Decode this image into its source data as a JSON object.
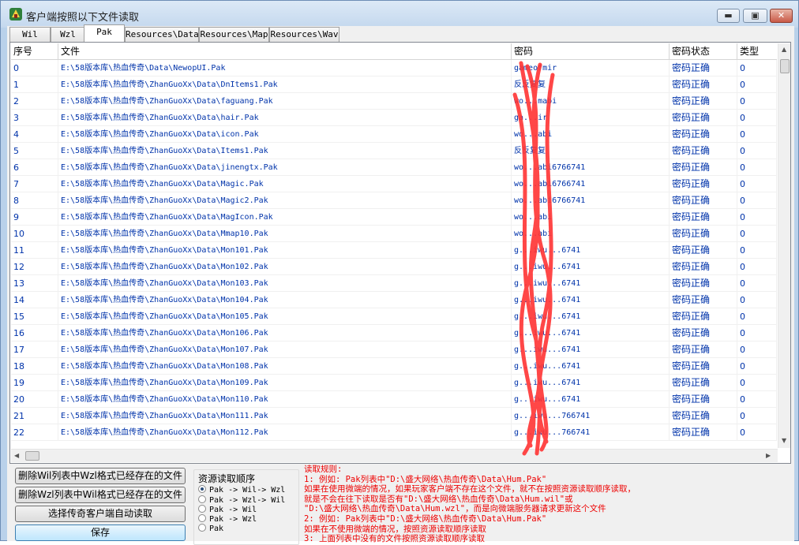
{
  "window": {
    "title": "客户端按照以下文件读取",
    "minimize_label": "▬",
    "maximize_label": "▣",
    "close_label": "✕"
  },
  "tabs": [
    {
      "label": "Wil"
    },
    {
      "label": "Wzl"
    },
    {
      "label": "Pak"
    },
    {
      "label": "Resources\\Data"
    },
    {
      "label": "Resources\\Map"
    },
    {
      "label": "Resources\\Wav"
    }
  ],
  "active_tab": "Pak",
  "table": {
    "columns": [
      "序号",
      "文件",
      "密码",
      "密码状态",
      "类型"
    ],
    "rows": [
      {
        "index": "0",
        "file": "E:\\58版本库\\热血传奇\\Data\\NewopUI.Pak",
        "password": "gameofmir",
        "status": "密码正确",
        "type": "0"
      },
      {
        "index": "1",
        "file": "E:\\58版本库\\热血传奇\\ZhanGuoXx\\Data\\DnItems1.Pak",
        "password": "反反复复",
        "status": "密码正确",
        "type": "0"
      },
      {
        "index": "2",
        "file": "E:\\58版本库\\热血传奇\\ZhanGuoXx\\Data\\faguang.Pak",
        "password": "wo...mabi",
        "status": "密码正确",
        "type": "0"
      },
      {
        "index": "3",
        "file": "E:\\58版本库\\热血传奇\\ZhanGuoXx\\Data\\hair.Pak",
        "password": "ga...ir",
        "status": "密码正确",
        "type": "0"
      },
      {
        "index": "4",
        "file": "E:\\58版本库\\热血传奇\\ZhanGuoXx\\Data\\icon.Pak",
        "password": "wo...abi",
        "status": "密码正确",
        "type": "0"
      },
      {
        "index": "5",
        "file": "E:\\58版本库\\热血传奇\\ZhanGuoXx\\Data\\Items1.Pak",
        "password": "反反复复",
        "status": "密码正确",
        "type": "0"
      },
      {
        "index": "6",
        "file": "E:\\58版本库\\热血传奇\\ZhanGuoXx\\Data\\jinengtx.Pak",
        "password": "wo...abi6766741",
        "status": "密码正确",
        "type": "0"
      },
      {
        "index": "7",
        "file": "E:\\58版本库\\热血传奇\\ZhanGuoXx\\Data\\Magic.Pak",
        "password": "wo...abi6766741",
        "status": "密码正确",
        "type": "0"
      },
      {
        "index": "8",
        "file": "E:\\58版本库\\热血传奇\\ZhanGuoXx\\Data\\Magic2.Pak",
        "password": "wo...abi6766741",
        "status": "密码正确",
        "type": "0"
      },
      {
        "index": "9",
        "file": "E:\\58版本库\\热血传奇\\ZhanGuoXx\\Data\\MagIcon.Pak",
        "password": "wo...abi",
        "status": "密码正确",
        "type": "0"
      },
      {
        "index": "10",
        "file": "E:\\58版本库\\热血传奇\\ZhanGuoXx\\Data\\Mmap10.Pak",
        "password": "wo...abi",
        "status": "密码正确",
        "type": "0"
      },
      {
        "index": "11",
        "file": "E:\\58版本库\\热血传奇\\ZhanGuoXx\\Data\\Mon101.Pak",
        "password": "g...iwu...6741",
        "status": "密码正确",
        "type": "0"
      },
      {
        "index": "12",
        "file": "E:\\58版本库\\热血传奇\\ZhanGuoXx\\Data\\Mon102.Pak",
        "password": "g...iwu...6741",
        "status": "密码正确",
        "type": "0"
      },
      {
        "index": "13",
        "file": "E:\\58版本库\\热血传奇\\ZhanGuoXx\\Data\\Mon103.Pak",
        "password": "g...iwu...6741",
        "status": "密码正确",
        "type": "0"
      },
      {
        "index": "14",
        "file": "E:\\58版本库\\热血传奇\\ZhanGuoXx\\Data\\Mon104.Pak",
        "password": "g...iwu...6741",
        "status": "密码正确",
        "type": "0"
      },
      {
        "index": "15",
        "file": "E:\\58版本库\\热血传奇\\ZhanGuoXx\\Data\\Mon105.Pak",
        "password": "g...iwu...6741",
        "status": "密码正确",
        "type": "0"
      },
      {
        "index": "16",
        "file": "E:\\58版本库\\热血传奇\\ZhanGuoXx\\Data\\Mon106.Pak",
        "password": "g...iwu...6741",
        "status": "密码正确",
        "type": "0"
      },
      {
        "index": "17",
        "file": "E:\\58版本库\\热血传奇\\ZhanGuoXx\\Data\\Mon107.Pak",
        "password": "g...iwu...6741",
        "status": "密码正确",
        "type": "0"
      },
      {
        "index": "18",
        "file": "E:\\58版本库\\热血传奇\\ZhanGuoXx\\Data\\Mon108.Pak",
        "password": "g...iwu...6741",
        "status": "密码正确",
        "type": "0"
      },
      {
        "index": "19",
        "file": "E:\\58版本库\\热血传奇\\ZhanGuoXx\\Data\\Mon109.Pak",
        "password": "g...iwu...6741",
        "status": "密码正确",
        "type": "0"
      },
      {
        "index": "20",
        "file": "E:\\58版本库\\热血传奇\\ZhanGuoXx\\Data\\Mon110.Pak",
        "password": "g...iwu...6741",
        "status": "密码正确",
        "type": "0"
      },
      {
        "index": "21",
        "file": "E:\\58版本库\\热血传奇\\ZhanGuoXx\\Data\\Mon111.Pak",
        "password": "g...iwu...766741",
        "status": "密码正确",
        "type": "0"
      },
      {
        "index": "22",
        "file": "E:\\58版本库\\热血传奇\\ZhanGuoXx\\Data\\Mon112.Pak",
        "password": "g...iwu...766741",
        "status": "密码正确",
        "type": "0"
      }
    ]
  },
  "buttons": {
    "delete_wil": "删除Wil列表中Wzl格式已经存在的文件",
    "delete_wzl": "删除Wzl列表中Wil格式已经存在的文件",
    "auto_read": "选择传奇客户端自动读取",
    "save": "保存"
  },
  "read_order": {
    "title": "资源读取顺序",
    "options": [
      "Pak -> Wil-> Wzl",
      "Pak -> Wzl-> Wil",
      "Pak -> Wil",
      "Pak -> Wzl",
      "Pak"
    ],
    "selected_index": 0
  },
  "rules": [
    "读取规则:",
    "1: 例如: Pak列表中\"D:\\盛大网络\\热血传奇\\Data\\Hum.Pak\"",
    "    如果在使用微端的情况，如果玩家客户端不存在这个文件，就不在按照资源读取顺序读取，",
    "    就是不会在往下读取是否有\"D:\\盛大网络\\热血传奇\\Data\\Hum.wil\"或",
    "  \"D:\\盛大网络\\热血传奇\\Data\\Hum.wzl\"，而是向微端服务器请求更新这个文件",
    "2: 例如: Pak列表中\"D:\\盛大网络\\热血传奇\\Data\\Hum.Pak\"",
    "    如果在不使用微端的情况，按照资源读取顺序读取",
    "3: 上面列表中没有的文件按照资源读取顺序读取"
  ],
  "colors": {
    "titlebar": "#c4d8ee",
    "list_text": "#0033aa",
    "rules_text": "#ee0000",
    "scribble": "#ff3333"
  }
}
